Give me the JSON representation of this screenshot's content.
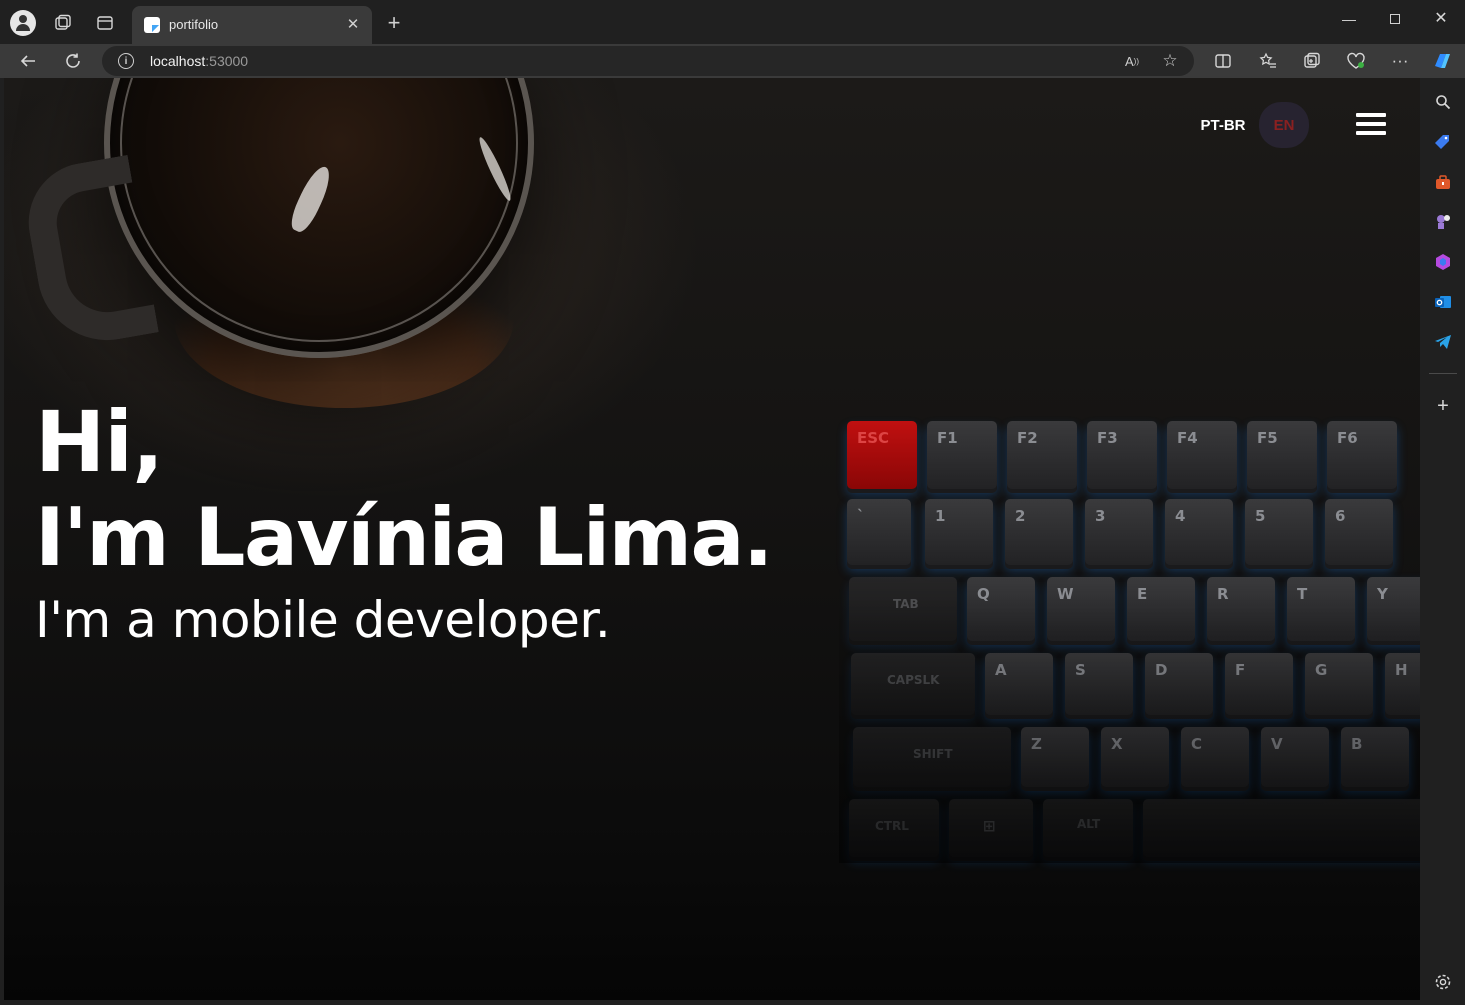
{
  "browser": {
    "tab": {
      "title": "portifolio",
      "close_glyph": "✕"
    },
    "new_tab_glyph": "+",
    "address": {
      "host": "localhost",
      "port": ":53000"
    },
    "window_controls": {
      "minimize": "—",
      "close": "✕"
    },
    "toolbar_icons": [
      "back-icon",
      "refresh-icon",
      "split-screen-icon",
      "favorites-icon",
      "collections-icon",
      "browser-essentials-icon",
      "more-icon",
      "copilot-icon"
    ],
    "sidebar_icons": [
      "search-icon",
      "shopping-icon",
      "tools-icon",
      "games-icon",
      "office-icon",
      "outlook-icon",
      "telegram-icon",
      "add-icon",
      "settings-icon"
    ]
  },
  "page": {
    "lang": {
      "pt": "PT-BR",
      "en": "EN",
      "selected": "EN"
    },
    "hero": {
      "greeting": "Hi,",
      "name": "I'm Lavínia Lima.",
      "subtitle": "I'm a mobile developer."
    },
    "keyboard_keys": {
      "row_fn": [
        "ESC",
        "F1",
        "F2",
        "F3",
        "F4",
        "F5",
        "F6"
      ],
      "row_num": [
        "`",
        "1",
        "2",
        "3",
        "4",
        "5",
        "6"
      ],
      "row_q": [
        "TAB",
        "Q",
        "W",
        "E",
        "R",
        "T",
        "Y"
      ],
      "row_a": [
        "CAPSLK",
        "A",
        "S",
        "D",
        "F",
        "G",
        "H"
      ],
      "row_z": [
        "SHIFT",
        "Z",
        "X",
        "C",
        "V",
        "B"
      ],
      "row_bottom": [
        "CTRL",
        "⊞",
        "ALT"
      ]
    }
  },
  "colors": {
    "accent_en": "#8a2020",
    "lang_pill": "#272330",
    "text": "#ffffff"
  }
}
